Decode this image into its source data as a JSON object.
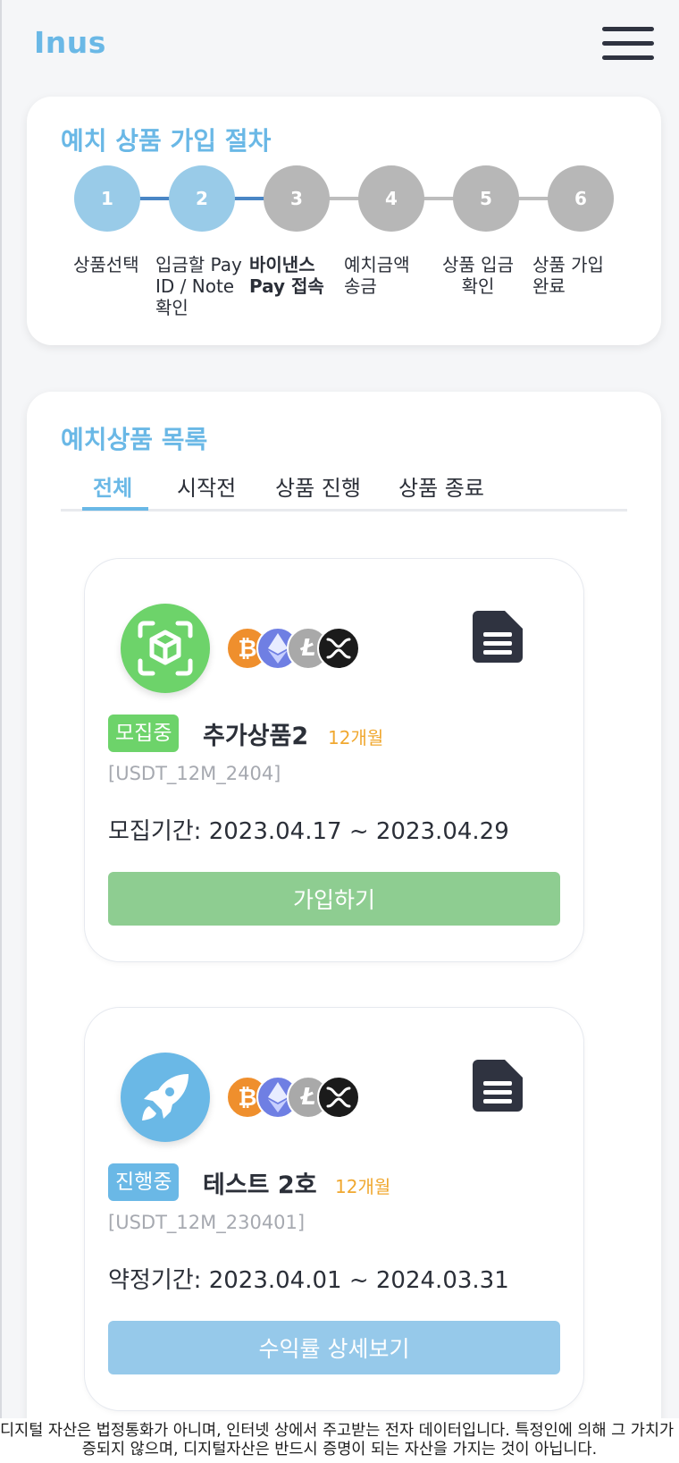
{
  "header": {
    "logo": "Inus"
  },
  "steps": {
    "title": "예치 상품 가입 절차",
    "items": [
      {
        "number": "1",
        "label": "상품선택",
        "state": "done"
      },
      {
        "number": "2",
        "label": "입금할 Pay ID / Note 확인",
        "state": "done"
      },
      {
        "number": "3",
        "label": "바이낸스 Pay 접속",
        "state": "current"
      },
      {
        "number": "4",
        "label": "예치금액 송금",
        "state": "pending"
      },
      {
        "number": "5",
        "label": "상품 입금 확인",
        "state": "pending"
      },
      {
        "number": "6",
        "label": "상품 가입 완료",
        "state": "pending"
      }
    ]
  },
  "list": {
    "title": "예치상품 목록",
    "tabs": [
      "전체",
      "시작전",
      "상품 진행",
      "상품 종료"
    ],
    "active_tab": "전체"
  },
  "products": [
    {
      "icon": "cube-scan-icon",
      "status": "모집중",
      "name": "추가상품2",
      "term": "12개월",
      "code": "[USDT_12M_2404]",
      "dates": "모집기간: 2023.04.17 ~ 2023.04.29",
      "button": "가입하기",
      "coins": [
        "bitcoin",
        "ethereum",
        "litecoin",
        "xrp"
      ]
    },
    {
      "icon": "rocket-icon",
      "status": "진행중",
      "name": "테스트 2호",
      "term": "12개월",
      "code": "[USDT_12M_230401]",
      "dates": "약정기간: 2023.04.01 ~ 2024.03.31",
      "button": "수익률 상세보기",
      "coins": [
        "bitcoin",
        "ethereum",
        "litecoin",
        "xrp"
      ]
    }
  ],
  "footer": {
    "line1": "디지털 자산은 법정통화가 아니며, 인터넷 상에서 주고받는 전자 데이터입니다. 특정인에 의해 그 가치가 보",
    "line2": "증되지 않으며, 디지털자산은 반드시 증명이 되는 자산을 가지는 것이 아닙니다."
  },
  "colors": {
    "accent": "#6ab8e6",
    "step_done": "#99cbe8",
    "step_pending": "#b7b7b7",
    "recruiting": "#6dd36a",
    "in_progress": "#6ab8e6",
    "join_button": "#8ecd91",
    "detail_button": "#96c9ea",
    "term": "#f0a830"
  }
}
